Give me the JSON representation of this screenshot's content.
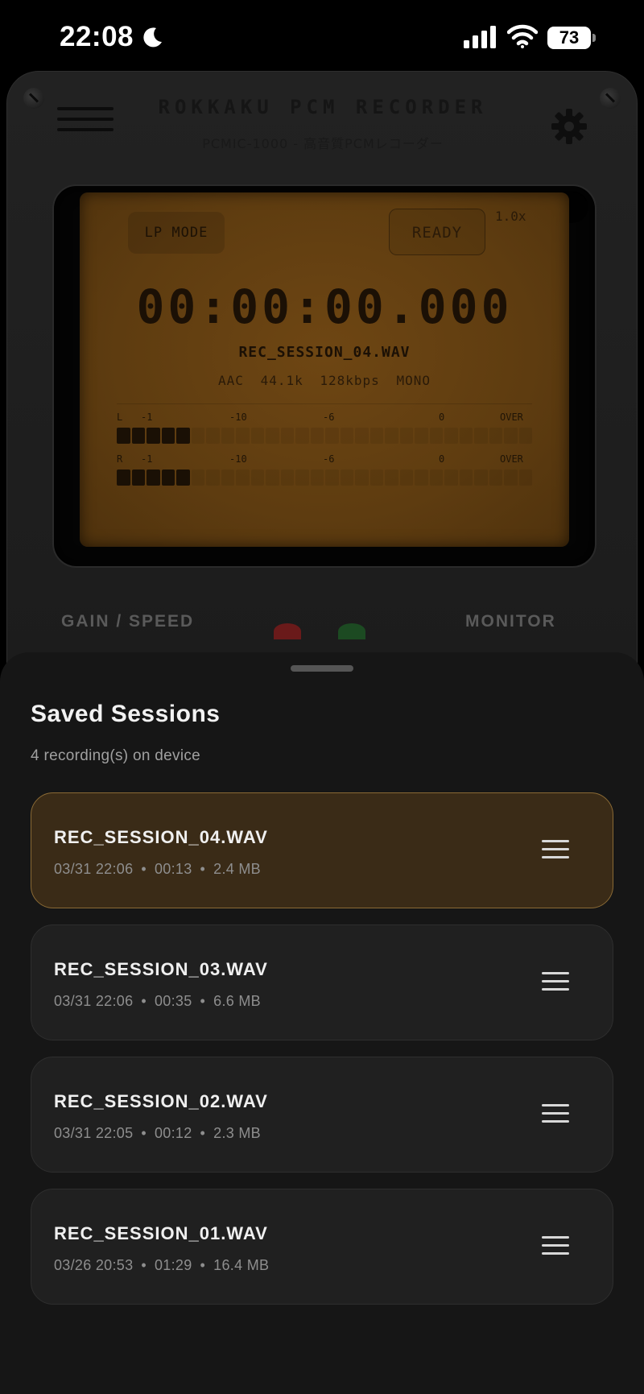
{
  "status_bar": {
    "time": "22:08",
    "battery": "73",
    "icons": [
      "moon-icon",
      "signal-icon",
      "wifi-icon",
      "battery-icon"
    ]
  },
  "device": {
    "brand_title": "ROKKAKU PCM RECORDER",
    "brand_subtitle": "PCMIC-1000 - 高音質PCMレコーダー",
    "icons": [
      "menu-icon",
      "gear-icon"
    ]
  },
  "lcd": {
    "mode": "LP MODE",
    "status": "READY",
    "speed": "1.0x",
    "time": "00:00:00.000",
    "filename": "REC_SESSION_04.WAV",
    "format": "AAC",
    "sample_rate": "44.1k",
    "bitrate": "128kbps",
    "channels": "MONO",
    "meter_left": {
      "channel": "L",
      "scale": [
        "-1",
        "-10",
        "-6",
        "0",
        "OVER"
      ],
      "level_segments": 5,
      "total_segments": 28
    },
    "meter_right": {
      "channel": "R",
      "scale": [
        "-1",
        "-10",
        "-6",
        "0",
        "OVER"
      ],
      "level_segments": 5,
      "total_segments": 28
    }
  },
  "controls": {
    "gain_label": "GAIN / SPEED",
    "monitor_label": "MONITOR"
  },
  "sessions_sheet": {
    "title": "Saved Sessions",
    "subtitle": "4 recording(s) on device",
    "separator": "•",
    "items": [
      {
        "name": "REC_SESSION_04.WAV",
        "date": "03/31 22:06",
        "duration": "00:13",
        "size": "2.4 MB",
        "active": true
      },
      {
        "name": "REC_SESSION_03.WAV",
        "date": "03/31 22:06",
        "duration": "00:35",
        "size": "6.6 MB",
        "active": false
      },
      {
        "name": "REC_SESSION_02.WAV",
        "date": "03/31 22:05",
        "duration": "00:12",
        "size": "2.3 MB",
        "active": false
      },
      {
        "name": "REC_SESSION_01.WAV",
        "date": "03/26 20:53",
        "duration": "01:29",
        "size": "16.4 MB",
        "active": false
      }
    ]
  },
  "colors": {
    "lcd_amber": "#6e4613",
    "active_session_bg": "#3a2b17",
    "active_session_border": "#8a6a35",
    "sheet_bg": "#161616"
  }
}
